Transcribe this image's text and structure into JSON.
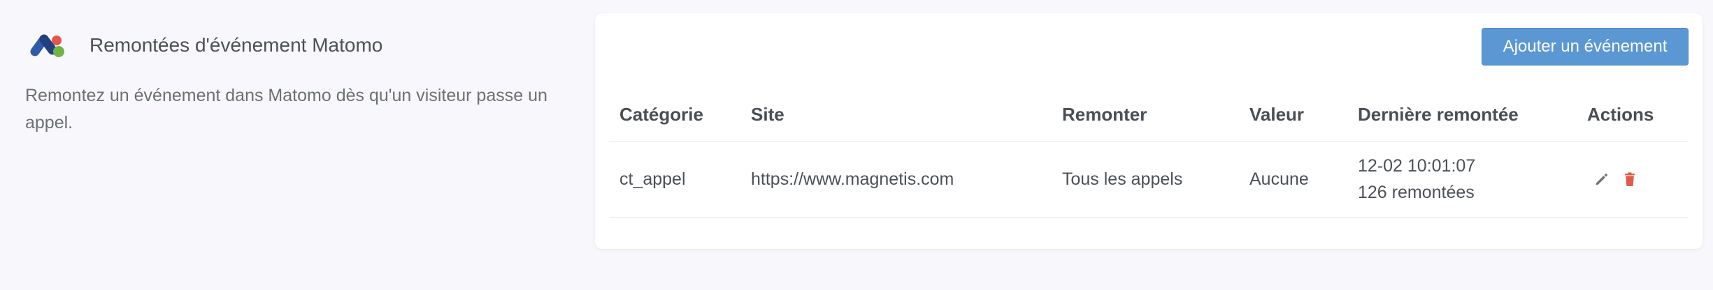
{
  "intro": {
    "title": "Remontées d'événement Matomo",
    "description": "Remontez un événement dans Matomo dès qu'un visiteur passe un appel.",
    "logo_icon": "matomo-logo"
  },
  "card": {
    "add_button_label": "Ajouter un événement",
    "columns": [
      "Catégorie",
      "Site",
      "Remonter",
      "Valeur",
      "Dernière remontée",
      "Actions"
    ],
    "rows": [
      {
        "category": "ct_appel",
        "site": "https://www.magnetis.com",
        "trigger": "Tous les appels",
        "value": "Aucune",
        "last_time": "12-02 10:01:07",
        "last_count": "126 remontées",
        "actions": [
          "pencil-icon",
          "trash-icon"
        ]
      }
    ]
  },
  "colors": {
    "primary_button": "#5b97d3",
    "delete_icon": "#e05a48",
    "edit_icon": "#6f757c",
    "background": "#f8f8fc"
  }
}
